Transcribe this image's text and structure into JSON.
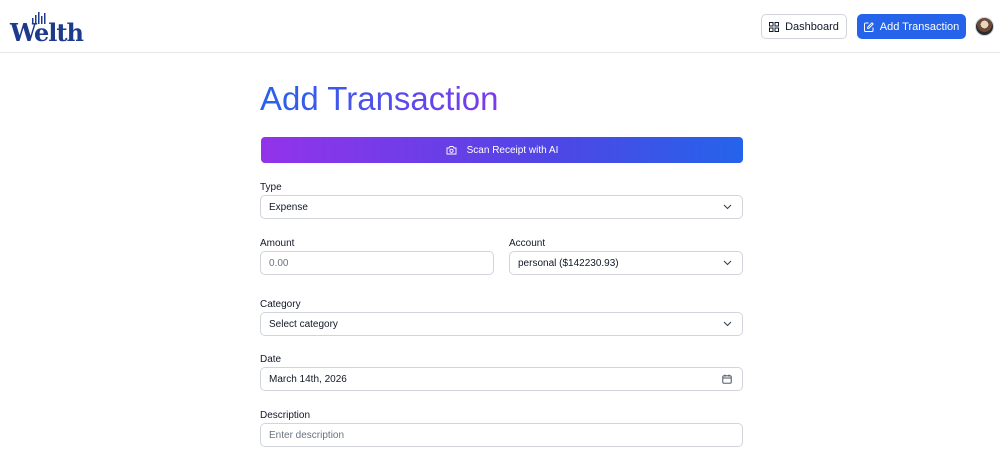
{
  "header": {
    "logo_text": "Welth",
    "dashboard_label": "Dashboard",
    "add_transaction_label": "Add Transaction"
  },
  "page": {
    "title": "Add Transaction",
    "scan_receipt_label": "Scan Receipt with AI"
  },
  "form": {
    "type": {
      "label": "Type",
      "value": "Expense"
    },
    "amount": {
      "label": "Amount",
      "placeholder": "0.00"
    },
    "account": {
      "label": "Account",
      "value": "personal ($142230.93)"
    },
    "category": {
      "label": "Category",
      "value": "Select category"
    },
    "date": {
      "label": "Date",
      "value": "March 14th, 2026"
    },
    "description": {
      "label": "Description",
      "placeholder": "Enter description"
    }
  },
  "icons": {
    "dashboard": "layout-grid-icon",
    "add": "pen-square-icon",
    "scan": "camera-icon",
    "select": "chevron-down-icon",
    "date": "calendar-icon"
  },
  "colors": {
    "brand": "#1e3a8a",
    "primary": "#2563eb",
    "gradient_start": "#9333ea",
    "gradient_end": "#2563eb"
  }
}
